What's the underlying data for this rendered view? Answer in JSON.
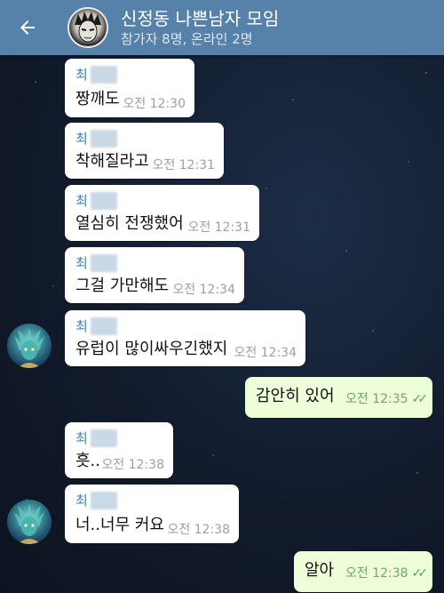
{
  "header": {
    "title": "신정동 나쁜남자 모임",
    "subtitle": "참가자 8명, 온라인 2명",
    "back_icon": "arrow-left-icon",
    "bg_color": "#5682a9"
  },
  "colors": {
    "incoming_bubble": "#ffffff",
    "outgoing_bubble": "#eefed9",
    "sender_name": "#3a82b8",
    "read_check": "#4fa94f"
  },
  "messages": [
    {
      "sender": "최",
      "text": "짱깨도",
      "time": "오전 12:30"
    },
    {
      "sender": "최",
      "text": "착해질라고",
      "time": "오전 12:31"
    },
    {
      "sender": "최",
      "text": "열심히 전쟁했어",
      "time": "오전 12:31"
    },
    {
      "sender": "최",
      "text": "그걸 가만해도",
      "time": "오전 12:34"
    },
    {
      "sender": "최",
      "text": "유럽이 많이싸우긴했지",
      "time": "오전 12:34"
    },
    {
      "text": "감안히 있어",
      "time": "오전 12:35"
    },
    {
      "sender": "최",
      "text": "흣..",
      "time": "오전 12:38"
    },
    {
      "sender": "최",
      "text": "너..너무 커요",
      "time": "오전 12:38"
    },
    {
      "text": "알아",
      "time": "오전 12:38"
    }
  ]
}
